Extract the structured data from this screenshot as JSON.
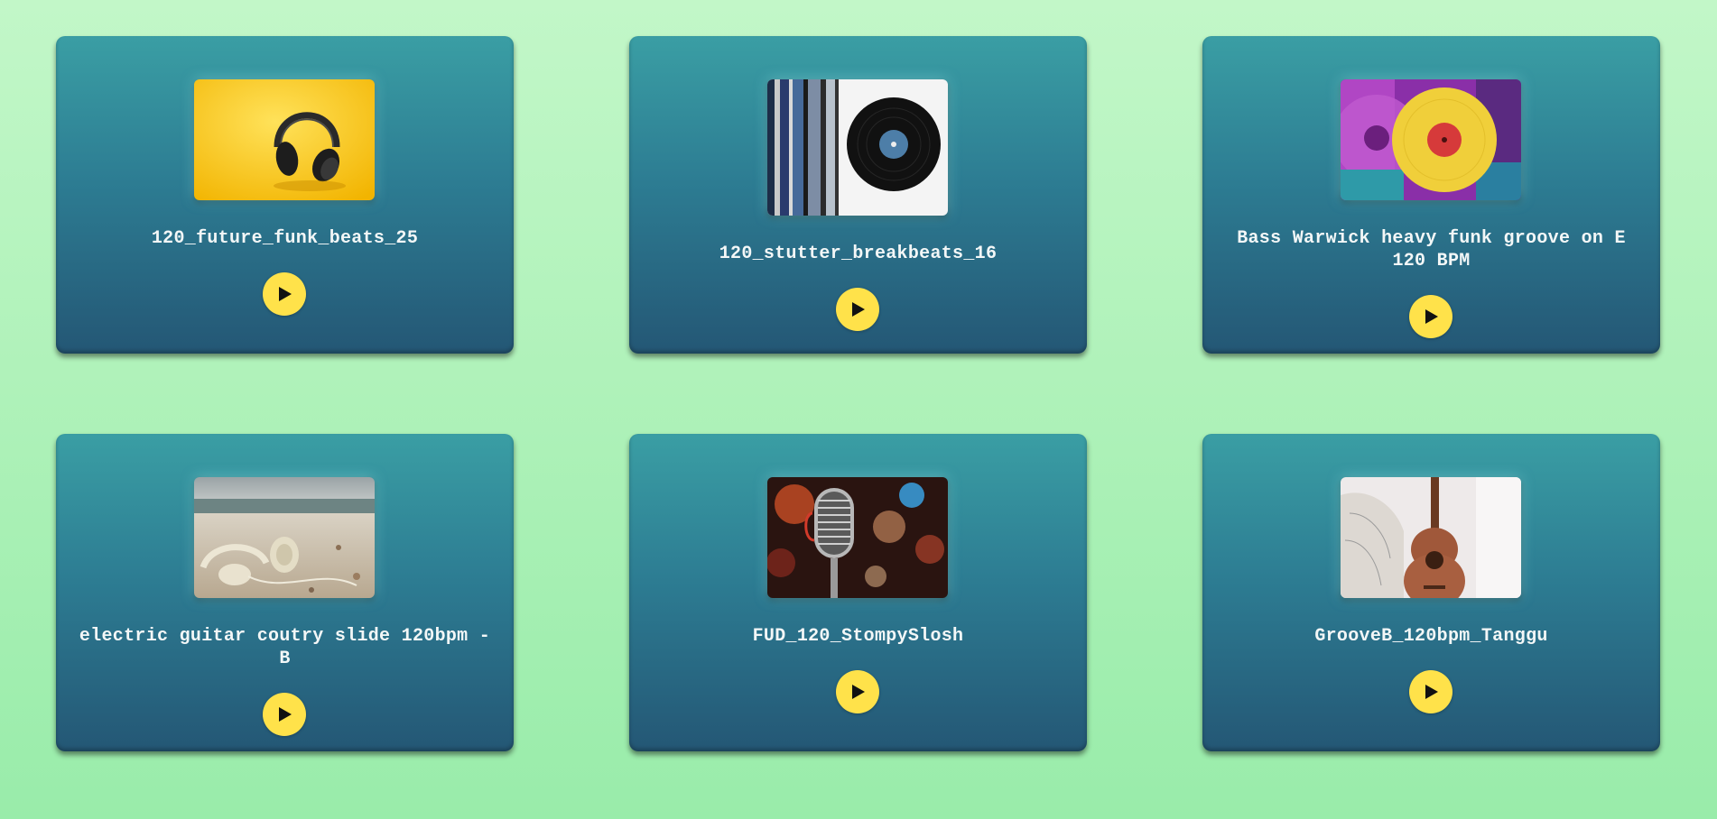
{
  "tracks": [
    {
      "title": "120_future_funk_beats_25",
      "thumbnail": "yellow-headphones-image",
      "action_icon": "play-icon"
    },
    {
      "title": "120_stutter_breakbeats_16",
      "thumbnail": "vinyl-records-image",
      "action_icon": "play-icon"
    },
    {
      "title": "Bass Warwick heavy funk groove on E 120 BPM",
      "thumbnail": "colored-vinyl-image",
      "action_icon": "play-icon"
    },
    {
      "title": "electric guitar coutry slide 120bpm - B",
      "thumbnail": "beach-headphones-image",
      "action_icon": "play-icon"
    },
    {
      "title": "FUD_120_StompySlosh",
      "thumbnail": "vintage-microphone-image",
      "action_icon": "play-icon"
    },
    {
      "title": "GrooveB_120bpm_Tanggu",
      "thumbnail": "acoustic-guitar-image",
      "action_icon": "play-icon"
    }
  ],
  "colors": {
    "background_top": "#c2f7c8",
    "background_bottom": "#99ecaa",
    "card_top": "#3a9ea4",
    "card_bottom": "#245775",
    "play_button": "#ffe24a",
    "title_text": "#f3f7f7"
  }
}
